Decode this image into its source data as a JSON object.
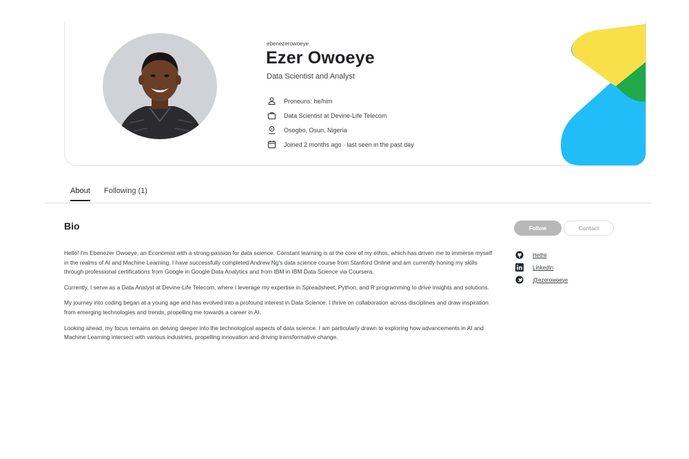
{
  "profile": {
    "username": "ebenezerowoeye",
    "name": "Ezer Owoeye",
    "tagline": "Data Scientist and Analyst",
    "details": [
      {
        "icon": "person-icon",
        "text": "Pronouns: he/him"
      },
      {
        "icon": "briefcase-icon",
        "text": "Data Scientist at Devine-Life Telecom"
      },
      {
        "icon": "location-pin-icon",
        "text": "Osogbo, Osun, Nigeria"
      },
      {
        "icon": "calendar-icon",
        "text": "Joined 2 months ago · last seen in the past day"
      }
    ]
  },
  "tabs": [
    {
      "label": "About",
      "active": true
    },
    {
      "label": "Following (1)",
      "active": false
    }
  ],
  "bio": {
    "title": "Bio",
    "paragraphs": [
      "Hello! I'm Ebenezer Owoeye, an Economist with a strong passion for data science. Constant learning is at the core of my ethos, which has driven me to immerse myself in the realms of AI and Machine Learning. I have successfully completed Andrew Ng's data science course from Stanford Online and am currently honing my skills through professional certifications from Google in Google Data Analytics and from IBM in IBM Data Science via Coursera.",
      "Currently, I serve as a Data Analyst at Devine-Life Telecom, where I leverage my expertise in Spreadsheet, Python, and R programming to drive insights and solutions.",
      "My journey into coding began at a young age and has evolved into a profound interest in Data Science. I thrive on collaboration across disciplines and draw inspiration from emerging technologies and trends, propelling me towards a career in AI.",
      "Looking ahead, my focus remains on delving deeper into the technological aspects of data science. I am particularly drawn to exploring how advancements in AI and Machine Learning intersect with various industries, propelling innovation and driving transformative change."
    ]
  },
  "actions": {
    "follow_label": "Follow",
    "contact_label": "Contact"
  },
  "social_links": [
    {
      "icon": "github-icon",
      "label": "Hethii"
    },
    {
      "icon": "linkedin-icon",
      "label": "LinkedIn"
    },
    {
      "icon": "twitter-icon",
      "label": "@ezerowoeye"
    }
  ],
  "colors": {
    "deco_yellow": "#f9e04b",
    "deco_green": "#20a84a",
    "deco_blue": "#20bdf8",
    "follow_bg": "#b8b8b8"
  }
}
